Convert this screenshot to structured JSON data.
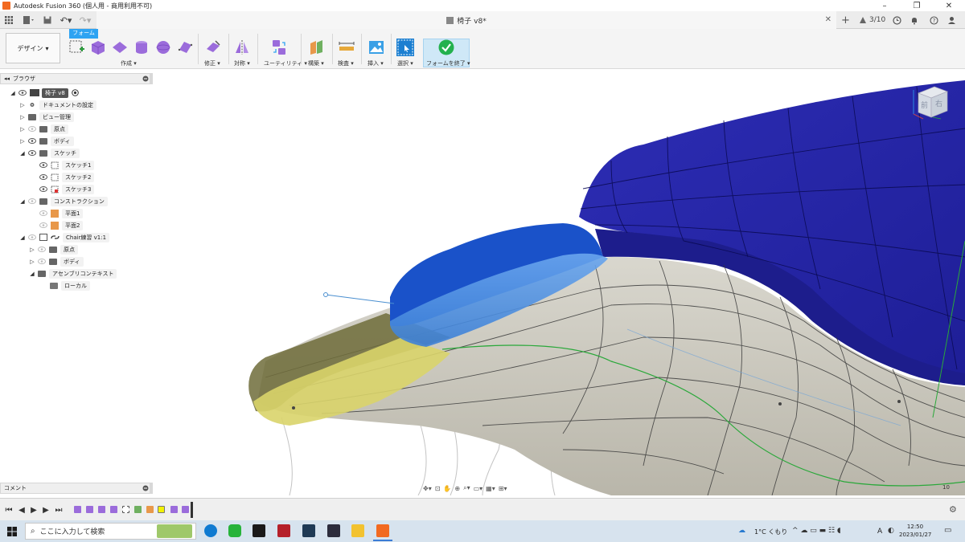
{
  "window": {
    "title": "Autodesk Fusion 360 (個人用 - 商用利用不可)",
    "controls": [
      "minimize",
      "restore",
      "close"
    ]
  },
  "document_tab": {
    "name": "椅子 v8*",
    "page_count": "3/10"
  },
  "ribbon": {
    "workspace": "デザイン",
    "active_tab": "フォーム",
    "groups": [
      {
        "label": "作成"
      },
      {
        "label": "修正"
      },
      {
        "label": "対称"
      },
      {
        "label": "ユーティリティ"
      },
      {
        "label": "構築"
      },
      {
        "label": "検査"
      },
      {
        "label": "挿入"
      },
      {
        "label": "選択"
      },
      {
        "label": "フォームを終了"
      }
    ]
  },
  "browser": {
    "title": "ブラウザ",
    "items": [
      {
        "label": "椅子 v8",
        "level": 0,
        "expanded": true,
        "active": true
      },
      {
        "label": "ドキュメントの設定",
        "level": 1,
        "expanded": false
      },
      {
        "label": "ビュー管理",
        "level": 1,
        "expanded": false
      },
      {
        "label": "原点",
        "level": 1,
        "expanded": false
      },
      {
        "label": "ボディ",
        "level": 1,
        "expanded": false
      },
      {
        "label": "スケッチ",
        "level": 1,
        "expanded": true
      },
      {
        "label": "スケッチ1",
        "level": 2
      },
      {
        "label": "スケッチ2",
        "level": 2
      },
      {
        "label": "スケッチ3",
        "level": 2
      },
      {
        "label": "コンストラクション",
        "level": 1,
        "expanded": true
      },
      {
        "label": "平面1",
        "level": 2
      },
      {
        "label": "平面2",
        "level": 2
      },
      {
        "label": "Chair練習 v1:1",
        "level": 1,
        "expanded": true
      },
      {
        "label": "原点",
        "level": 2,
        "expanded": false
      },
      {
        "label": "ボディ",
        "level": 2,
        "expanded": false
      },
      {
        "label": "アセンブリコンテキスト",
        "level": 2,
        "expanded": true
      },
      {
        "label": "ローカル",
        "level": 3
      }
    ]
  },
  "comment_panel": {
    "title": "コメント"
  },
  "viewport": {
    "viewcube_labels": [
      "前",
      "右"
    ],
    "zoom_indicator": "10"
  },
  "taskbar": {
    "search_placeholder": "ここに入力して検索",
    "weather": "1°C くもり",
    "time": "12:50",
    "date": "2023/01/27",
    "ime": "A"
  },
  "colors": {
    "accent": "#2ea3f2",
    "form_blue": "#2222a8",
    "selected_face": "#4a8fe0",
    "underside": "#c8c6bc",
    "yellow_face": "#d9d46a",
    "finish_green": "#23b14d"
  }
}
